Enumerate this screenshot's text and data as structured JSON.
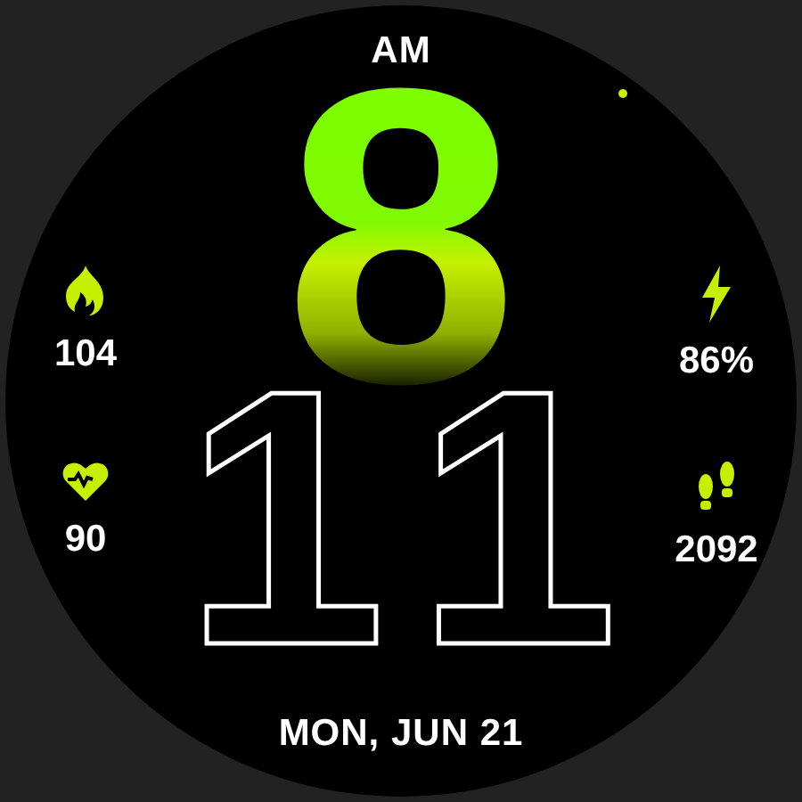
{
  "period": "AM",
  "hour": "8",
  "minute": "11",
  "left_stats": [
    {
      "kind": "calories",
      "value": "104"
    },
    {
      "kind": "heart_rate",
      "value": "90"
    }
  ],
  "right_stats": [
    {
      "kind": "battery",
      "value": "86%"
    },
    {
      "kind": "steps",
      "value": "2092"
    }
  ],
  "date": "MON, JUN 21"
}
